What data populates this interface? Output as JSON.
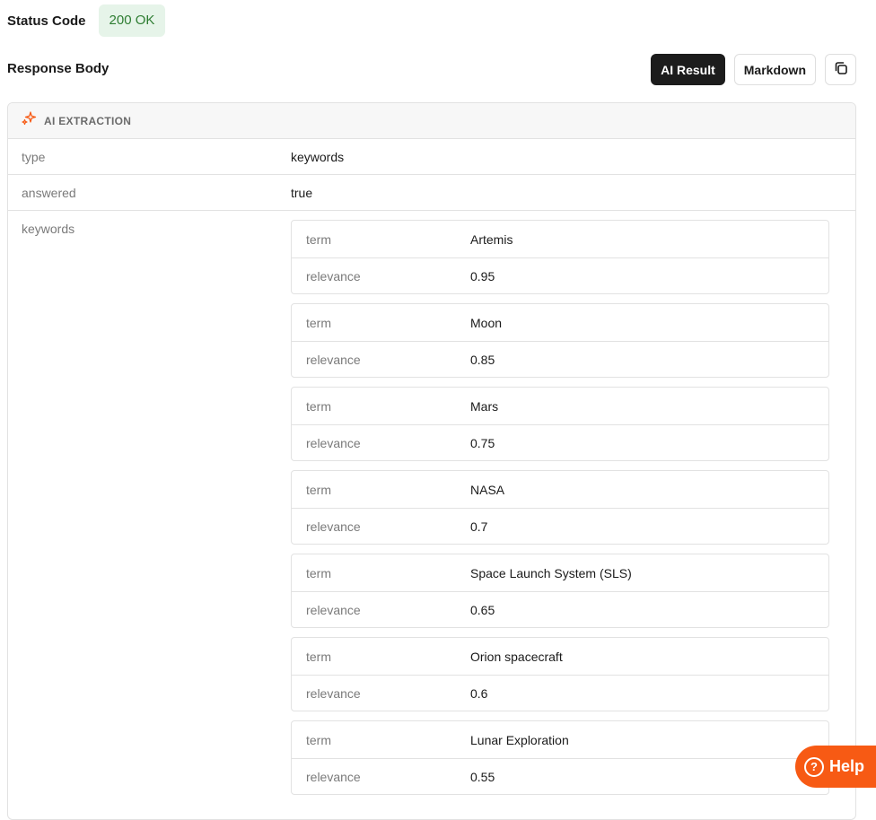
{
  "status": {
    "label": "Status Code",
    "badge": "200 OK"
  },
  "response": {
    "label": "Response Body",
    "ai_result_label": "AI Result",
    "markdown_label": "Markdown",
    "copy_icon": "copy-icon"
  },
  "panel": {
    "header_icon": "sparkle-icon",
    "header_label": "AI EXTRACTION",
    "rows": {
      "type": {
        "key": "type",
        "value": "keywords"
      },
      "answered": {
        "key": "answered",
        "value": "true"
      },
      "keywords_key": "keywords"
    },
    "keywords": [
      {
        "term_key": "term",
        "term": "Artemis",
        "relevance_key": "relevance",
        "relevance": "0.95"
      },
      {
        "term_key": "term",
        "term": "Moon",
        "relevance_key": "relevance",
        "relevance": "0.85"
      },
      {
        "term_key": "term",
        "term": "Mars",
        "relevance_key": "relevance",
        "relevance": "0.75"
      },
      {
        "term_key": "term",
        "term": "NASA",
        "relevance_key": "relevance",
        "relevance": "0.7"
      },
      {
        "term_key": "term",
        "term": "Space Launch System (SLS)",
        "relevance_key": "relevance",
        "relevance": "0.65"
      },
      {
        "term_key": "term",
        "term": "Orion spacecraft",
        "relevance_key": "relevance",
        "relevance": "0.6"
      },
      {
        "term_key": "term",
        "term": "Lunar Exploration",
        "relevance_key": "relevance",
        "relevance": "0.55"
      }
    ]
  },
  "help": {
    "label": "Help",
    "icon": "help-icon"
  },
  "colors": {
    "accent": "#f75a14",
    "success_bg": "#e6f4e9",
    "success_text": "#2e7d32",
    "dark_button": "#1c1c1c"
  }
}
